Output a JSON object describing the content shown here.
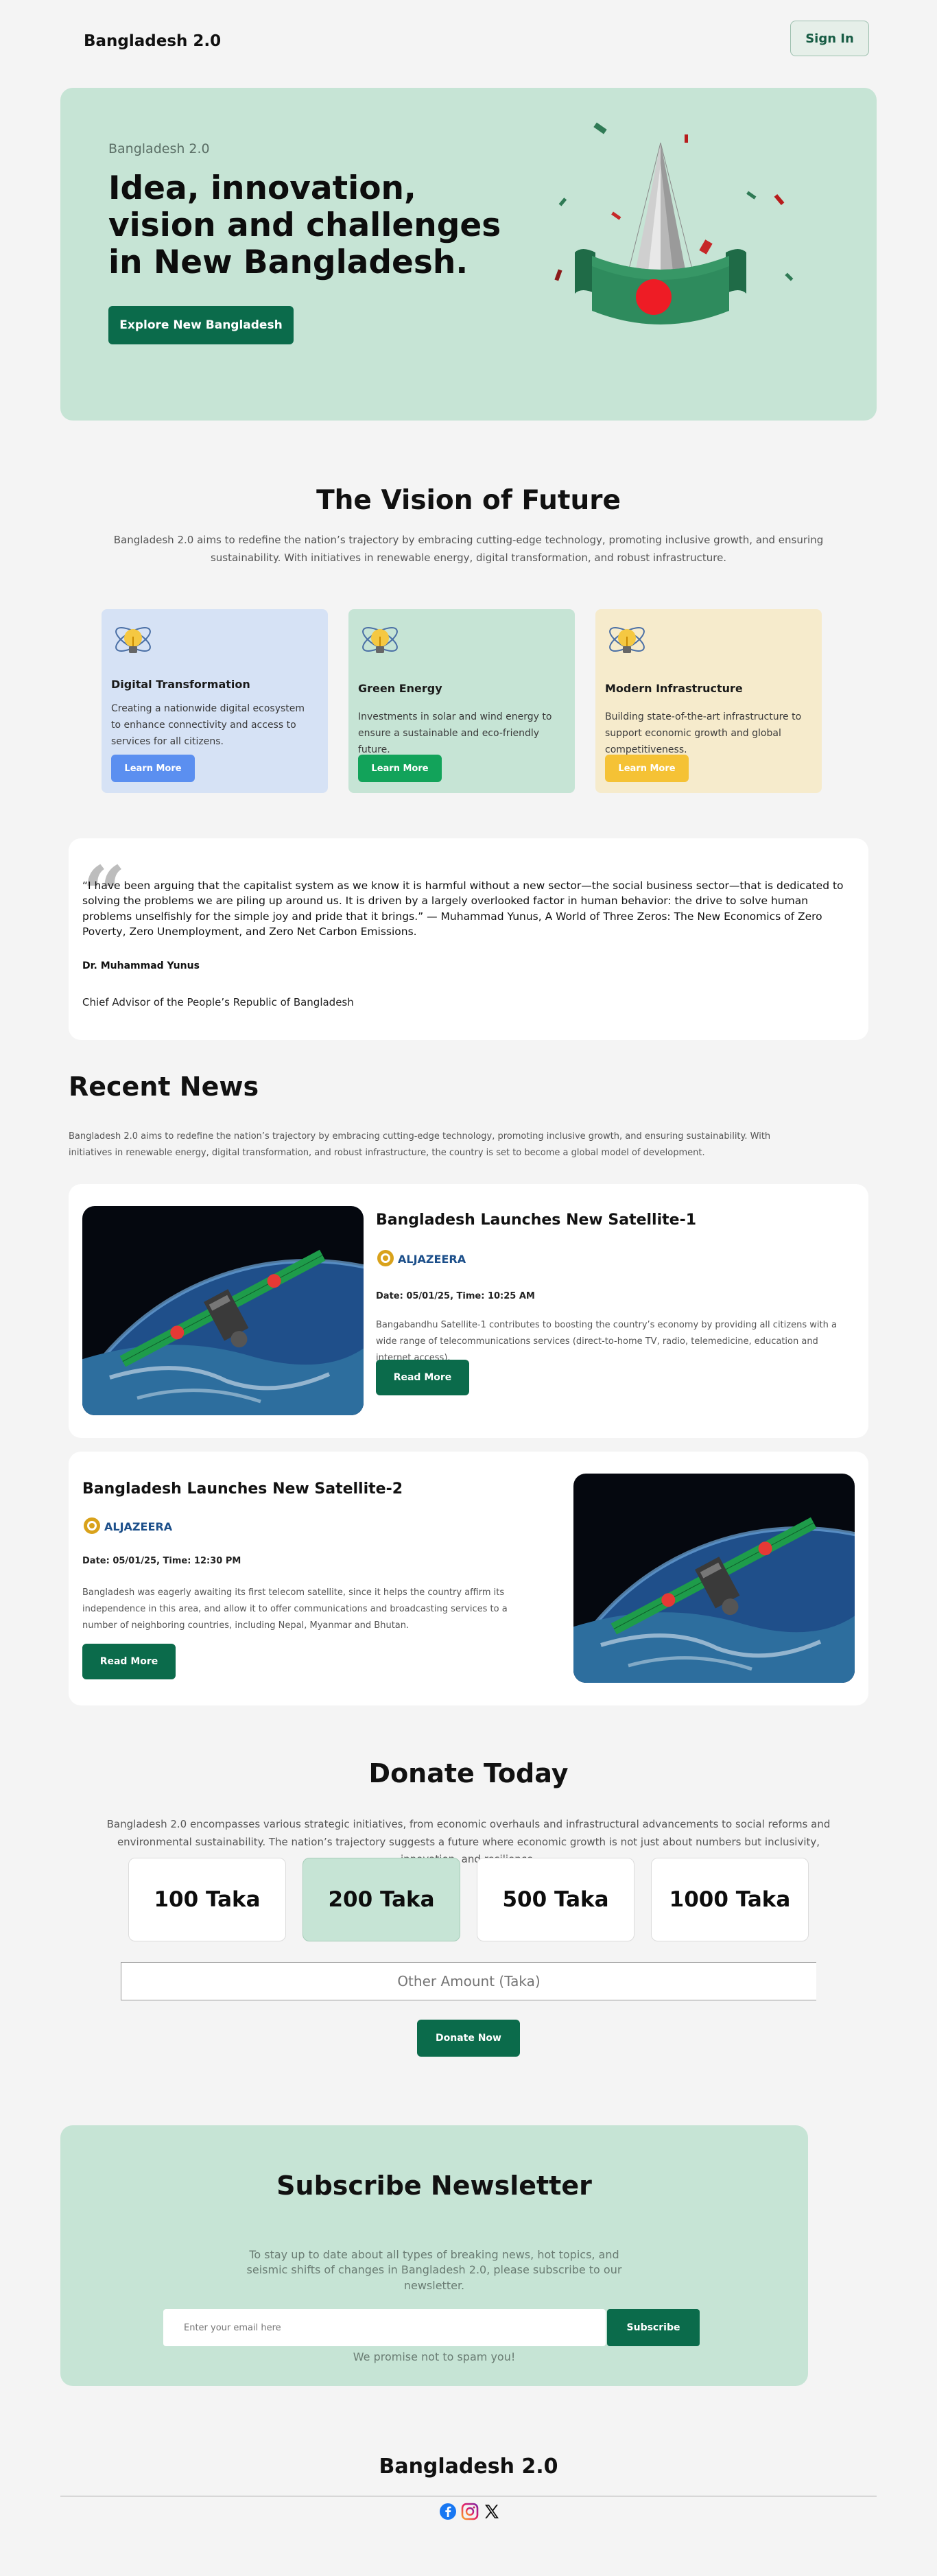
{
  "header": {
    "brand": "Bangladesh 2.0",
    "signin_label": "Sign In"
  },
  "hero": {
    "eyebrow": "Bangladesh 2.0",
    "title": "Idea, innovation, vision and challenges in New Bangladesh.",
    "button_label": "Explore New Bangladesh"
  },
  "vision": {
    "title": "The Vision of Future",
    "description": "Bangladesh 2.0 aims to redefine the nation’s trajectory by embracing cutting-edge technology, promoting inclusive growth, and ensuring sustainability. With initiatives in renewable energy, digital transformation, and robust infrastructure.",
    "cards": [
      {
        "title": "Digital Transformation",
        "description": "Creating a nationwide digital ecosystem to enhance connectivity and access to services for all citizens.",
        "button_label": "Learn More",
        "bg_color": "#d6e2f5",
        "button_color": "#5b8ff0"
      },
      {
        "title": "Green Energy",
        "description": "Investments in solar and wind energy to ensure a sustainable and eco-friendly future.",
        "button_label": "Learn More",
        "bg_color": "#c6e4d5",
        "button_color": "#12a35a"
      },
      {
        "title": "Modern Infrastructure",
        "description": "Building state-of-the-art infrastructure to support economic growth and global competitiveness.",
        "button_label": "Learn More",
        "bg_color": "#f6ebcc",
        "button_color": "#f5c235"
      }
    ]
  },
  "quote": {
    "text": "“I have been arguing that the capitalist system as we know it is harmful without a new sector—the social business sector—that is dedicated to solving the problems we are piling up around us. It is driven by a largely overlooked factor in human behavior: the drive to solve human problems unselfishly for the simple joy and pride that it brings.” — Muhammad Yunus, A World of Three Zeros: The New Economics of Zero Poverty, Zero Unemployment, and Zero Net Carbon Emissions.",
    "author": "Dr. Muhammad Yunus",
    "role": "Chief Advisor of the People’s Republic of Bangladesh"
  },
  "news": {
    "title": "Recent News",
    "description": "Bangladesh 2.0 aims to redefine the nation’s trajectory by embracing cutting-edge technology, promoting inclusive growth, and ensuring sustainability. With initiatives in renewable energy, digital transformation, and robust infrastructure, the country is set to become a global model of development.",
    "items": [
      {
        "title": "Bangladesh Launches New Satellite-1",
        "source": "ALJAZEERA",
        "date": "Date: 05/01/25, Time: 10:25 AM",
        "body": "Bangabandhu Satellite-1 contributes to boosting the country’s economy by providing all citizens with a wide range of telecommunications services (direct-to-home TV, radio, telemedicine, education and internet access).",
        "button_label": "Read More"
      },
      {
        "title": "Bangladesh Launches New Satellite-2",
        "source": "ALJAZEERA",
        "date": "Date: 05/01/25, Time: 12:30 PM",
        "body": "Bangladesh was eagerly awaiting its first telecom satellite, since it helps the country affirm its independence in this area, and allow it to offer communications and broadcasting services to a number of neighboring countries, including Nepal, Myanmar and Bhutan.",
        "button_label": "Read More"
      }
    ]
  },
  "donate": {
    "title": "Donate Today",
    "description": "Bangladesh 2.0 encompasses various strategic initiatives, from economic overhauls and infrastructural advancements to social reforms and environmental sustainability. The nation’s trajectory suggests a future where economic growth is not just about numbers but inclusivity, innovation, and resilience.",
    "amounts": [
      "100 Taka",
      "200 Taka",
      "500 Taka",
      "1000 Taka"
    ],
    "selected_amount": "200 Taka",
    "other_placeholder": "Other Amount (Taka)",
    "button_label": "Donate Now"
  },
  "newsletter": {
    "title": "Subscribe Newsletter",
    "description": "To stay up to date about all types of breaking news, hot topics, and seismic shifts of changes in Bangladesh 2.0, please subscribe to our newsletter.",
    "email_placeholder": "Enter your email here",
    "button_label": "Subscribe",
    "note": "We promise not to spam you!"
  },
  "footer": {
    "brand": "Bangladesh 2.0",
    "socials": [
      "facebook-icon",
      "instagram-icon",
      "x-icon"
    ]
  },
  "colors": {
    "primary": "#0b6b4b",
    "mint": "#c6e4d5",
    "page_bg": "#f4f4f4"
  }
}
